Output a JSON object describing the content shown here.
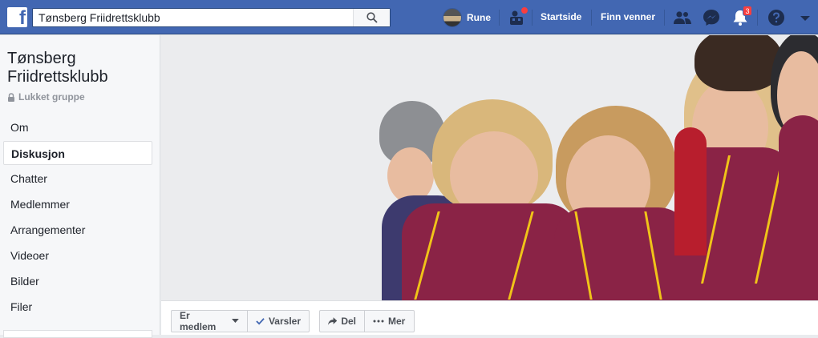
{
  "topbar": {
    "search_value": "Tønsberg Friidrettsklubb",
    "user_name": "Rune",
    "home_label": "Startside",
    "find_friends_label": "Finn venner",
    "notifications_count": "3"
  },
  "sidebar": {
    "group_name": "Tønsberg Friidrettsklubb",
    "privacy": "Lukket gruppe",
    "items": [
      {
        "label": "Om"
      },
      {
        "label": "Diskusjon"
      },
      {
        "label": "Chatter"
      },
      {
        "label": "Medlemmer"
      },
      {
        "label": "Arrangementer"
      },
      {
        "label": "Videoer"
      },
      {
        "label": "Bilder"
      },
      {
        "label": "Filer"
      }
    ]
  },
  "actions": {
    "member_label": "Er medlem",
    "notify_label": "Varsler",
    "share_label": "Del",
    "more_label": "Mer"
  },
  "colors": {
    "brand": "#4267b2",
    "jacket": "#8a2346",
    "badge": "#fa3e3e"
  }
}
